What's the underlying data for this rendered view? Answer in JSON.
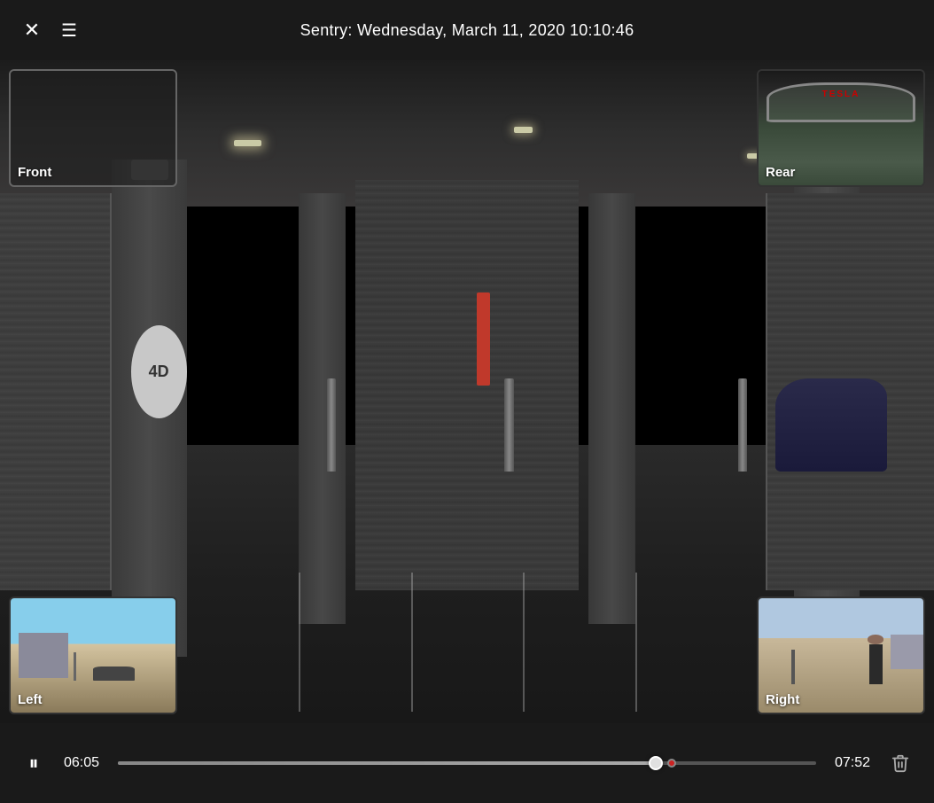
{
  "header": {
    "title": "Sentry: Wednesday, March 11, 2020 10:10:46",
    "close_label": "×",
    "menu_label": "☰"
  },
  "cameras": {
    "front": {
      "label": "Front"
    },
    "rear": {
      "label": "Rear"
    },
    "left": {
      "label": "Left"
    },
    "right": {
      "label": "Right"
    }
  },
  "controls": {
    "current_time": "06:05",
    "total_time": "07:52",
    "progress_percent": 77,
    "play_icon": "⏸",
    "delete_icon": "🗑"
  },
  "icons": {
    "close": "✕",
    "menu": "☰",
    "pause": "⏸",
    "trash": "🗑"
  }
}
